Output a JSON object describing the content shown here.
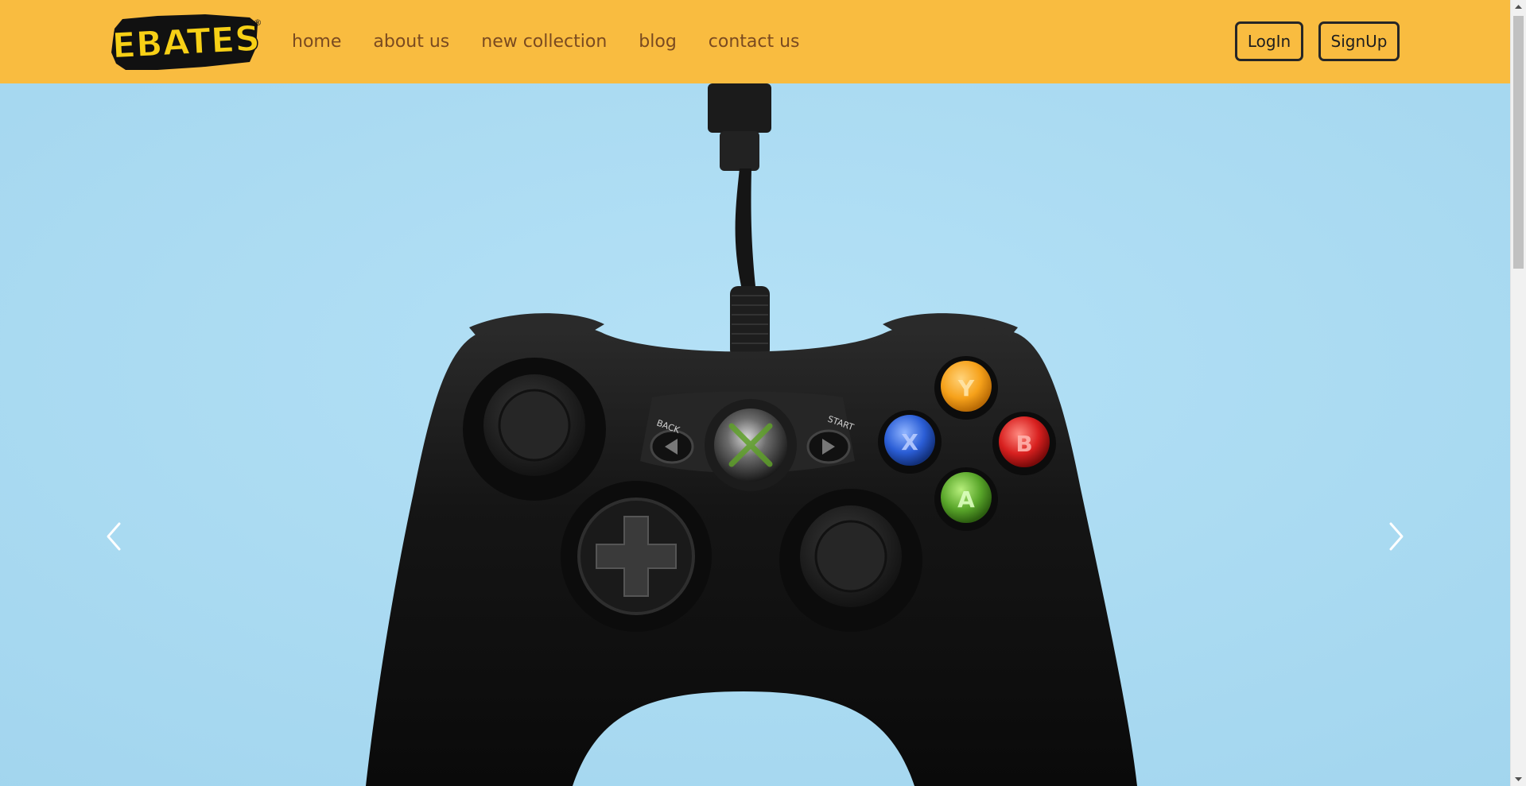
{
  "header": {
    "logo_text": "EBATES",
    "logo_mark": "®",
    "nav": [
      {
        "label": "home"
      },
      {
        "label": "about us"
      },
      {
        "label": "new collection"
      },
      {
        "label": "blog"
      },
      {
        "label": "contact us"
      }
    ],
    "login_label": "LogIn",
    "signup_label": "SignUp"
  },
  "hero": {
    "image": "black game controller on light blue background",
    "controller_labels": {
      "back": "BACK",
      "start": "START",
      "y": "Y",
      "x": "X",
      "b": "B",
      "a": "A"
    },
    "prev_icon": "chevron-left-icon",
    "next_icon": "chevron-right-icon"
  },
  "colors": {
    "header_bg": "#f9bc40",
    "nav_text": "#7a4a20",
    "hero_bg": "#acdcf3",
    "logo_yellow": "#f7d016",
    "button_y": "#f6a11a",
    "button_x": "#2b5ed6",
    "button_b": "#d8201f",
    "button_a": "#59a62a"
  }
}
